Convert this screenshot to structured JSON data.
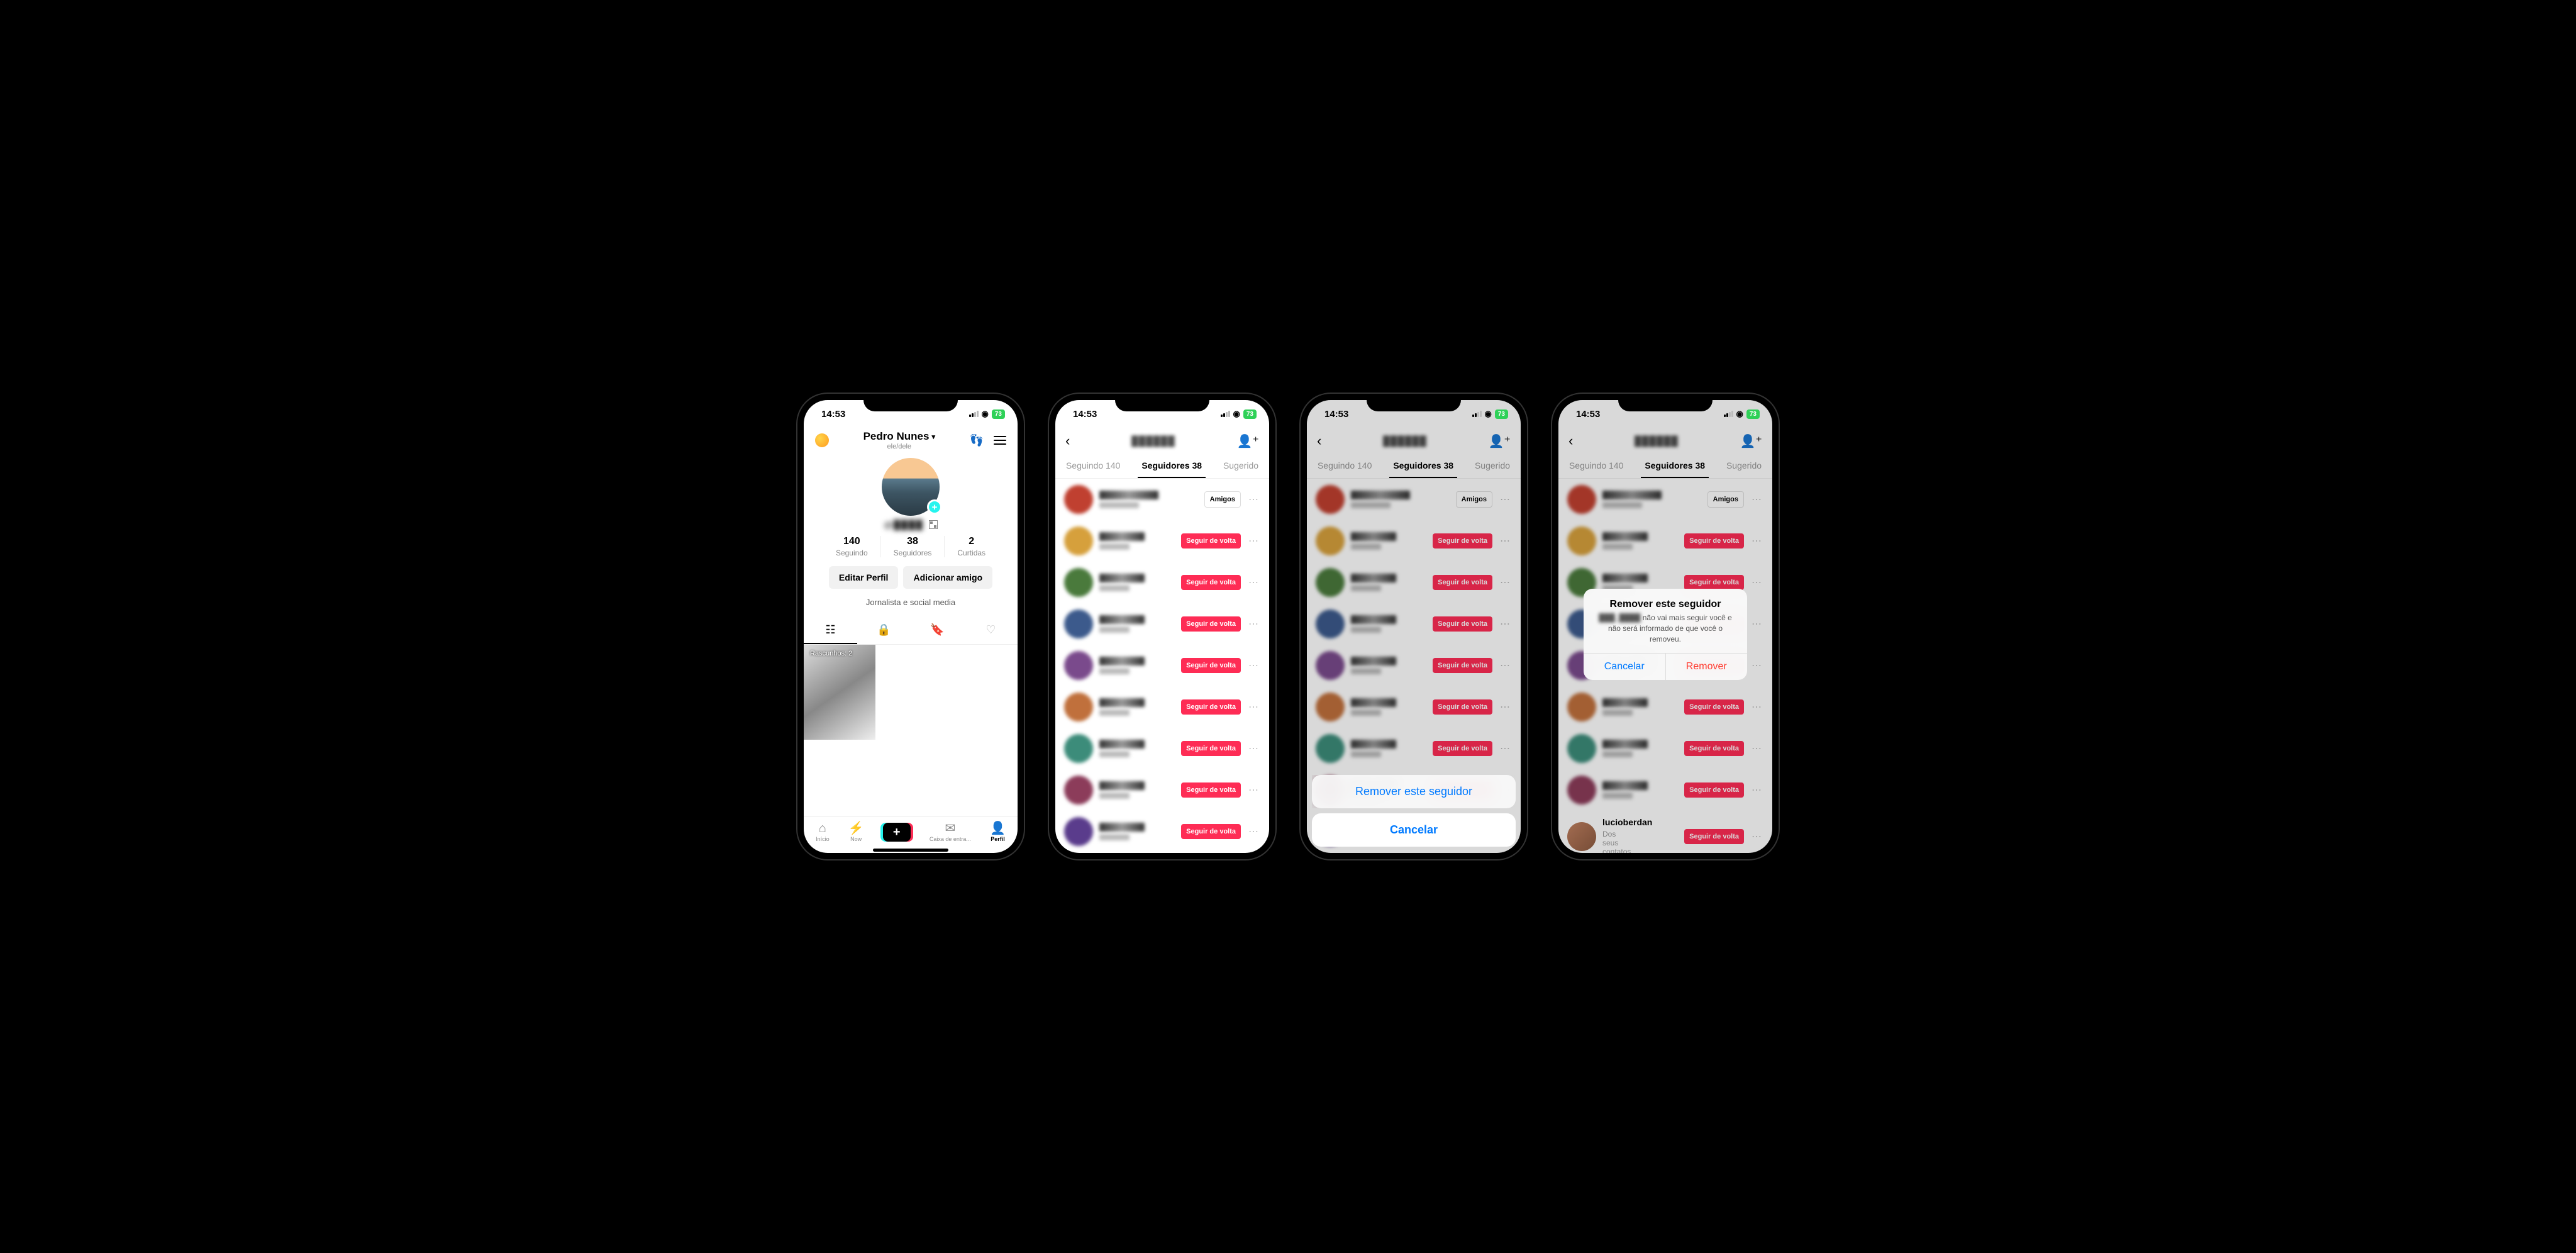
{
  "status": {
    "time": "14:53",
    "battery": "73"
  },
  "profile": {
    "name": "Pedro Nunes",
    "pronouns": "ele/dele",
    "handle": "@████",
    "stats": {
      "following_num": "140",
      "following_label": "Seguindo",
      "followers_num": "38",
      "followers_label": "Seguidores",
      "likes_num": "2",
      "likes_label": "Curtidas"
    },
    "edit_btn": "Editar Perfil",
    "add_friend_btn": "Adicionar amigo",
    "bio": "Jornalista e social media",
    "drafts_label": "Rascunhos: 2",
    "nav": {
      "home": "Início",
      "now": "Now",
      "inbox": "Caixa de entra...",
      "profile": "Perfil"
    }
  },
  "followers_screen": {
    "tabs": {
      "following": "Seguindo 140",
      "followers": "Seguidores 38",
      "suggested": "Sugerido"
    },
    "btn_friends": "Amigos",
    "btn_follow_back": "Seguir de volta",
    "visible_user": "lucioberdan",
    "contacts_hint": "Dos seus contatos"
  },
  "action_sheet": {
    "remove": "Remover este seguidor",
    "cancel": "Cancelar"
  },
  "alert": {
    "title": "Remover este seguidor",
    "message": "não vai mais seguir você e não será informado de que você o removeu.",
    "blurred_name": "███_████",
    "cancel": "Cancelar",
    "remove": "Remover"
  },
  "avatar_colors": [
    "#c04030",
    "#d6a03c",
    "#4a7a3c",
    "#3c5a8c",
    "#7a4a8c",
    "#c0703c",
    "#3c8c7a",
    "#8c3c5a",
    "#5a3c8c"
  ]
}
